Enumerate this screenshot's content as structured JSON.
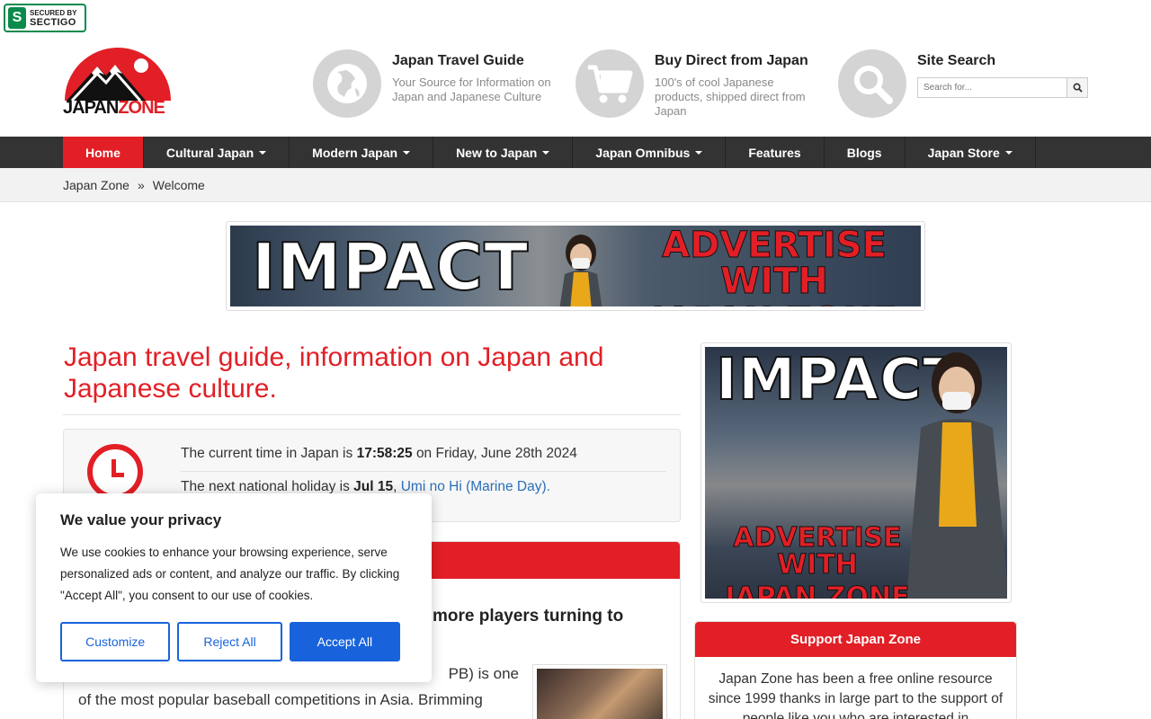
{
  "badge": {
    "line1": "SECURED BY",
    "line2": "SECTIGO"
  },
  "logo": {
    "part1": "JAPAN",
    "part2": "ZONE"
  },
  "header": {
    "blocks": [
      {
        "title": "Japan Travel Guide",
        "desc": "Your Source for Information on Japan and Japanese Culture",
        "icon": "globe-icon"
      },
      {
        "title": "Buy Direct from Japan",
        "desc": "100's of cool Japanese products, shipped direct from Japan",
        "icon": "cart-icon"
      },
      {
        "title": "Site Search",
        "icon": "search-icon"
      }
    ],
    "search_placeholder": "Search for..."
  },
  "nav": {
    "items": [
      {
        "label": "Home",
        "active": true,
        "dropdown": false
      },
      {
        "label": "Cultural Japan",
        "dropdown": true
      },
      {
        "label": "Modern Japan",
        "dropdown": true
      },
      {
        "label": "New to Japan",
        "dropdown": true
      },
      {
        "label": "Japan Omnibus",
        "dropdown": true
      },
      {
        "label": "Features",
        "dropdown": false
      },
      {
        "label": "Blogs",
        "dropdown": false
      },
      {
        "label": "Japan Store",
        "dropdown": true
      }
    ]
  },
  "breadcrumb": {
    "root": "Japan Zone",
    "sep": "»",
    "current": "Welcome"
  },
  "ads": {
    "impact": "IMPACT",
    "advertise": "ADVERTISE WITH",
    "brand": "JAPAN ZONE"
  },
  "main": {
    "title": "Japan travel guide, information on Japan and Japanese culture.",
    "time_prefix": "The current time in Japan is",
    "time_value": "17:58:25",
    "time_suffix": "on Friday, June 28th 2024",
    "holiday_prefix": "The next national holiday is",
    "holiday_date": "Jul 15",
    "holiday_name": "Umi no Hi (Marine Day).",
    "news_title": "more players turning to",
    "news_body_1": "PB) is one",
    "news_body_2": "of the most popular baseball competitions in Asia. Brimming"
  },
  "support": {
    "title": "Support Japan Zone",
    "body": "Japan Zone has been a free online resource since 1999 thanks in large part to the support of people like you who are interested in"
  },
  "cookie": {
    "title": "We value your privacy",
    "body": "We use cookies to enhance your browsing experience, serve personalized ads or content, and analyze our traffic. By clicking \"Accept All\", you consent to our use of cookies.",
    "customize": "Customize",
    "reject": "Reject All",
    "accept": "Accept All"
  },
  "colors": {
    "brand_red": "#e21f26",
    "nav_dark": "#333333",
    "link_blue": "#2a6fb8",
    "cookie_blue": "#1863dc"
  }
}
